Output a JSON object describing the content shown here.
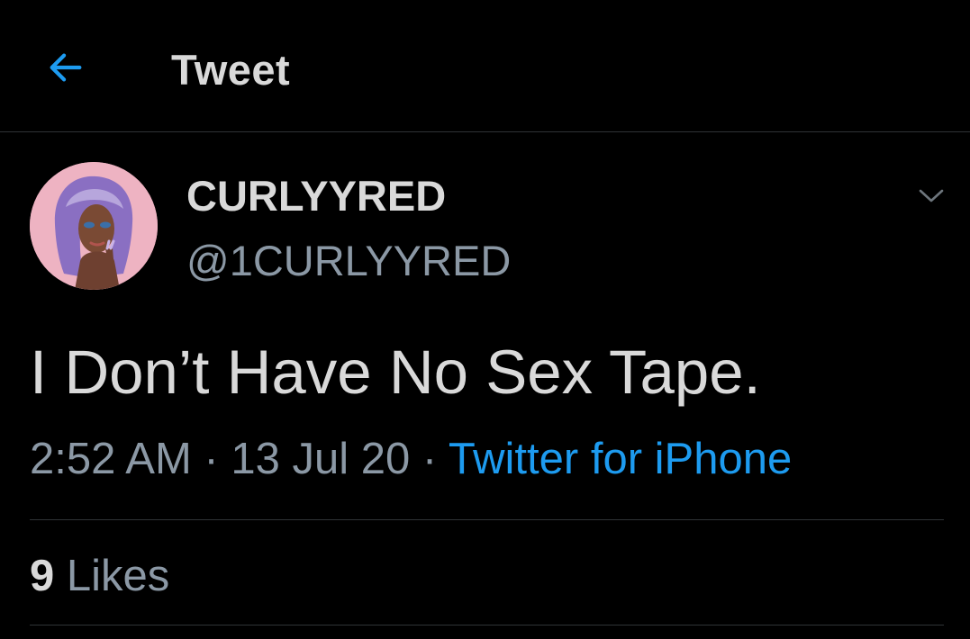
{
  "header": {
    "back_icon": "arrow-left-icon",
    "title": "Tweet"
  },
  "colors": {
    "background": "#000000",
    "text": "#d9d9d9",
    "muted": "#8b98a5",
    "accent": "#1d9bf0",
    "divider": "#2f3336"
  },
  "tweet": {
    "author": {
      "name": "CURLYYRED",
      "handle": "@1CURLYYRED",
      "avatar_icon": "profile-avatar"
    },
    "more_icon": "chevron-down-icon",
    "text": "I Don’t Have No Sex Tape.",
    "time": "2:52 AM",
    "separator": "·",
    "date": "13 Jul 20",
    "source": "Twitter for iPhone",
    "likes": {
      "count": "9",
      "label": "Likes"
    }
  }
}
